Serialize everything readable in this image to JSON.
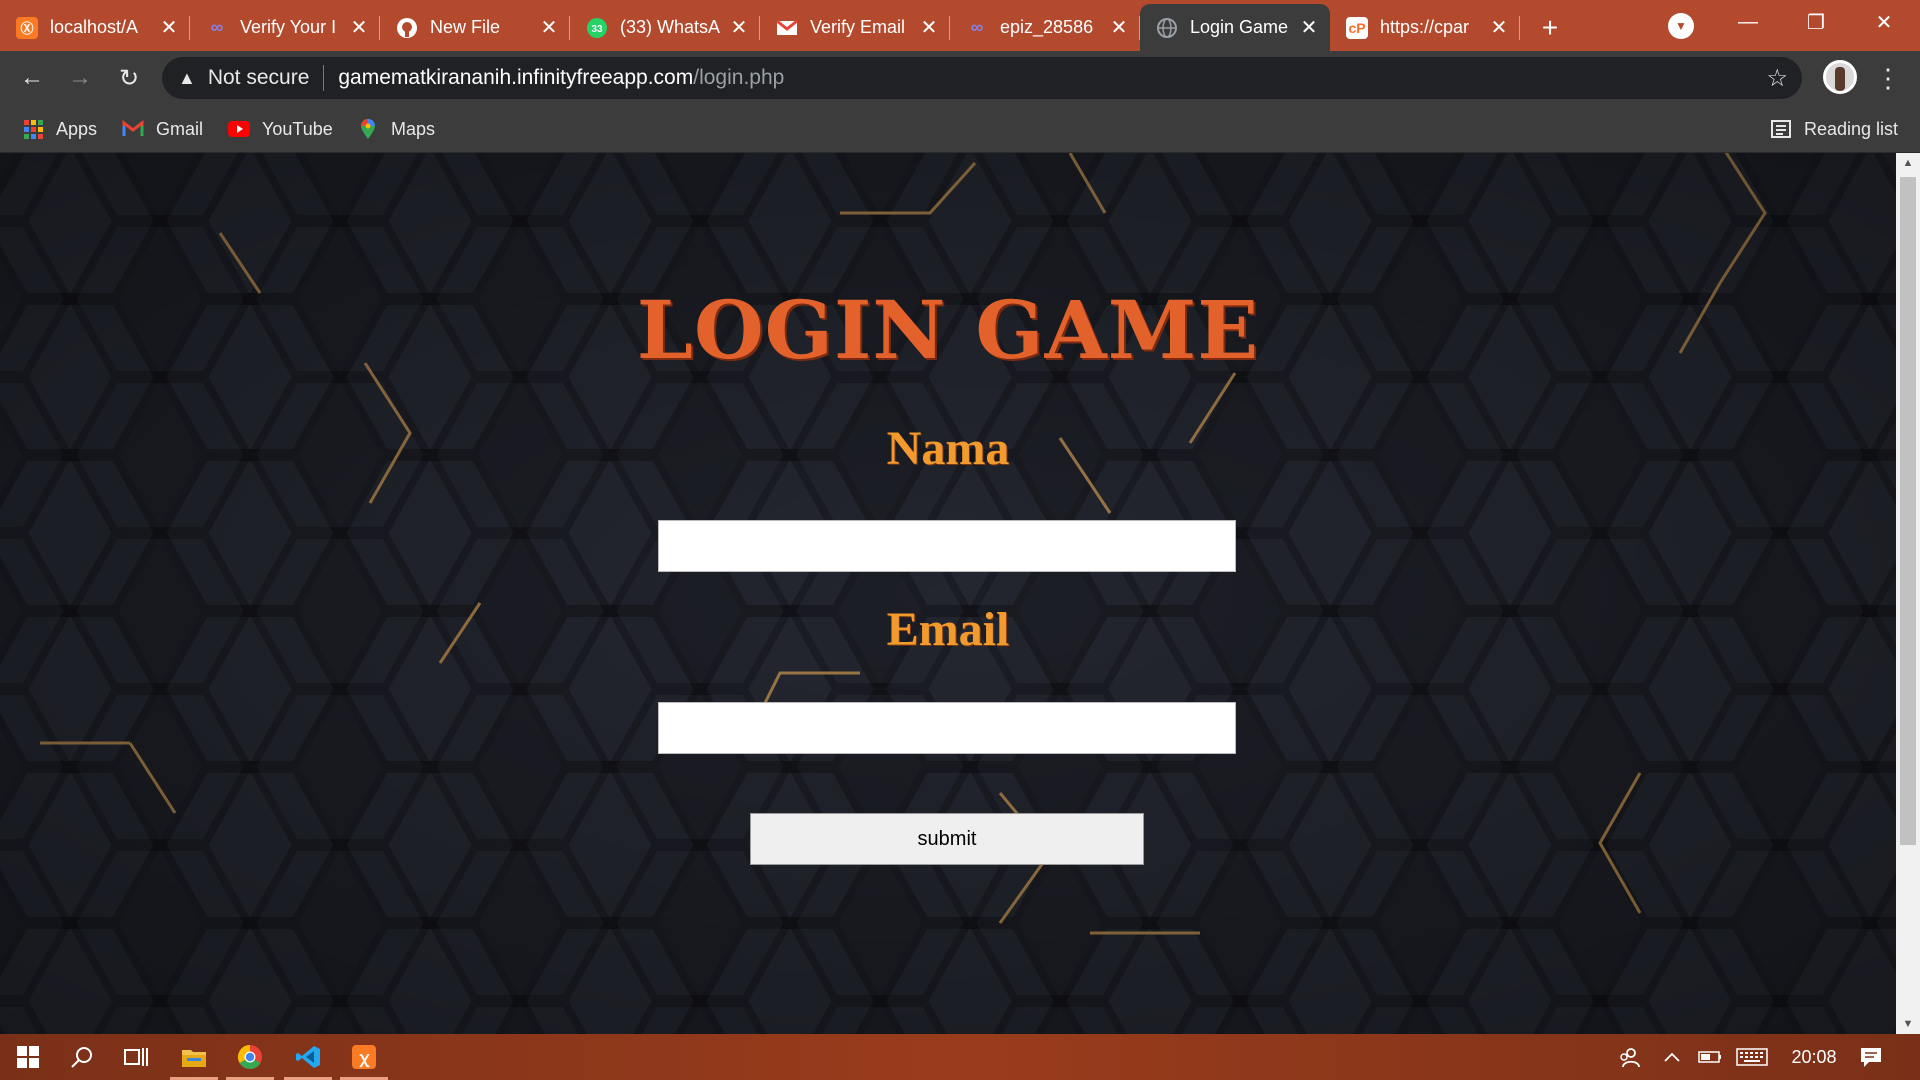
{
  "browser": {
    "tabs": [
      {
        "title": "localhost/A",
        "favicon": "xampp-icon",
        "color": "#fb7a24"
      },
      {
        "title": "Verify Your I",
        "favicon": "infinity-icon",
        "color": "#6a5acd"
      },
      {
        "title": "New File",
        "favicon": "github-icon",
        "color": "#ffffff"
      },
      {
        "title": "(33) WhatsA",
        "favicon": "whatsapp-icon",
        "color": "#25d366"
      },
      {
        "title": "Verify Email",
        "favicon": "gmail-icon",
        "color": "#ea4335"
      },
      {
        "title": "epiz_28586",
        "favicon": "infinity-icon",
        "color": "#6a5acd"
      },
      {
        "title": "Login Game",
        "favicon": "globe-icon",
        "color": "#9aa0a6",
        "active": true
      },
      {
        "title": "https://cpar",
        "favicon": "cpanel-icon",
        "color": "#ff6c2c"
      }
    ],
    "address": {
      "security_label": "Not secure",
      "host": "gamematkirananih.infinityfreeapp.com",
      "path": "/login.php"
    },
    "bookmarks": [
      {
        "label": "Apps",
        "icon": "apps-grid-icon"
      },
      {
        "label": "Gmail",
        "icon": "gmail-icon"
      },
      {
        "label": "YouTube",
        "icon": "youtube-icon"
      },
      {
        "label": "Maps",
        "icon": "maps-icon"
      }
    ],
    "reading_list": "Reading list"
  },
  "page": {
    "title": "LOGIN GAME",
    "nama_label": "Nama",
    "nama_value": "",
    "email_label": "Email",
    "email_value": "",
    "submit_label": "submit"
  },
  "taskbar": {
    "clock": "20:08"
  },
  "colors": {
    "tabbar": "#b34a2e",
    "toolbar": "#3c3c3c",
    "title_orange": "#e3622c",
    "label_orange": "#f29a2e",
    "hex_gold": "#d8a35a"
  }
}
